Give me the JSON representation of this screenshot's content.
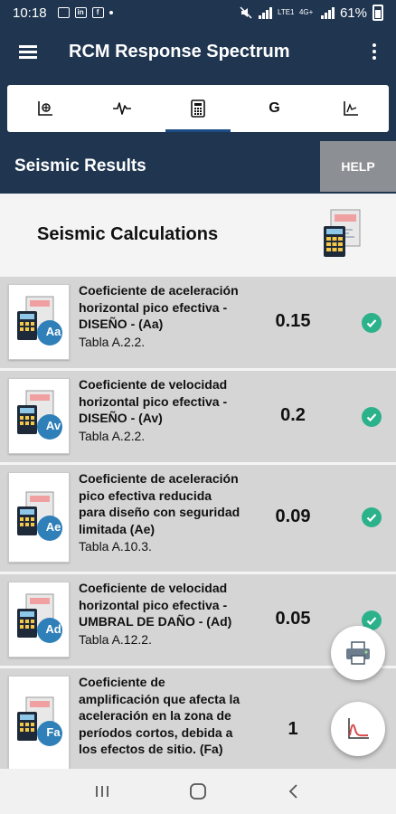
{
  "status_bar": {
    "time": "10:18",
    "battery": "61%",
    "carrier": "LTE1",
    "data": "4G+"
  },
  "app_bar": {
    "title": "RCM Response Spectrum"
  },
  "tabs": [
    {
      "icon": "spectrum-chart-icon",
      "active": false
    },
    {
      "icon": "waveform-icon",
      "active": false
    },
    {
      "icon": "calculator-icon",
      "active": true
    },
    {
      "label": "G",
      "icon": "g-letter-icon",
      "active": false
    },
    {
      "icon": "plot-chart-icon",
      "active": false
    }
  ],
  "section": {
    "title": "Seismic Results",
    "help_label": "HELP"
  },
  "calc_header": {
    "title": "Seismic Calculations",
    "icon": "calculator-document-icon"
  },
  "rows": [
    {
      "badge": "Aa",
      "title": "Coeficiente de aceleración horizontal pico efectiva - DISEÑO - (Aa)",
      "ref": "Tabla A.2.2.",
      "value": "0.15",
      "status": "check-icon"
    },
    {
      "badge": "Av",
      "title": "Coeficiente de velocidad horizontal pico efectiva - DISEÑO - (Av)",
      "ref": "Tabla A.2.2.",
      "value": "0.2",
      "status": "check-icon"
    },
    {
      "badge": "Ae",
      "title": "Coeficiente de aceleración pico efectiva reducida para diseño con seguridad limitada (Ae)",
      "ref": "Tabla A.10.3.",
      "value": "0.09",
      "status": "check-icon"
    },
    {
      "badge": "Ad",
      "title": "Coeficiente de velocidad horizontal pico efectiva - UMBRAL DE DAÑO - (Ad)",
      "ref": "Tabla A.12.2.",
      "value": "0.05",
      "status": "check-icon"
    },
    {
      "badge": "Fa",
      "title": "Coeficiente de amplificación que afecta la aceleración en la zona de períodos cortos, debida a los efectos de sitio. (Fa)",
      "ref": "",
      "value": "1",
      "status": ""
    }
  ],
  "fabs": {
    "print": "printer-icon",
    "chart": "spectrum-curve-icon"
  },
  "nav": {
    "recents": "recents-icon",
    "home": "home-icon",
    "back": "back-icon"
  },
  "colors": {
    "primary": "#1f3550",
    "accent": "#1d4d86",
    "check": "#2bb28a",
    "help": "#8c8f93"
  }
}
